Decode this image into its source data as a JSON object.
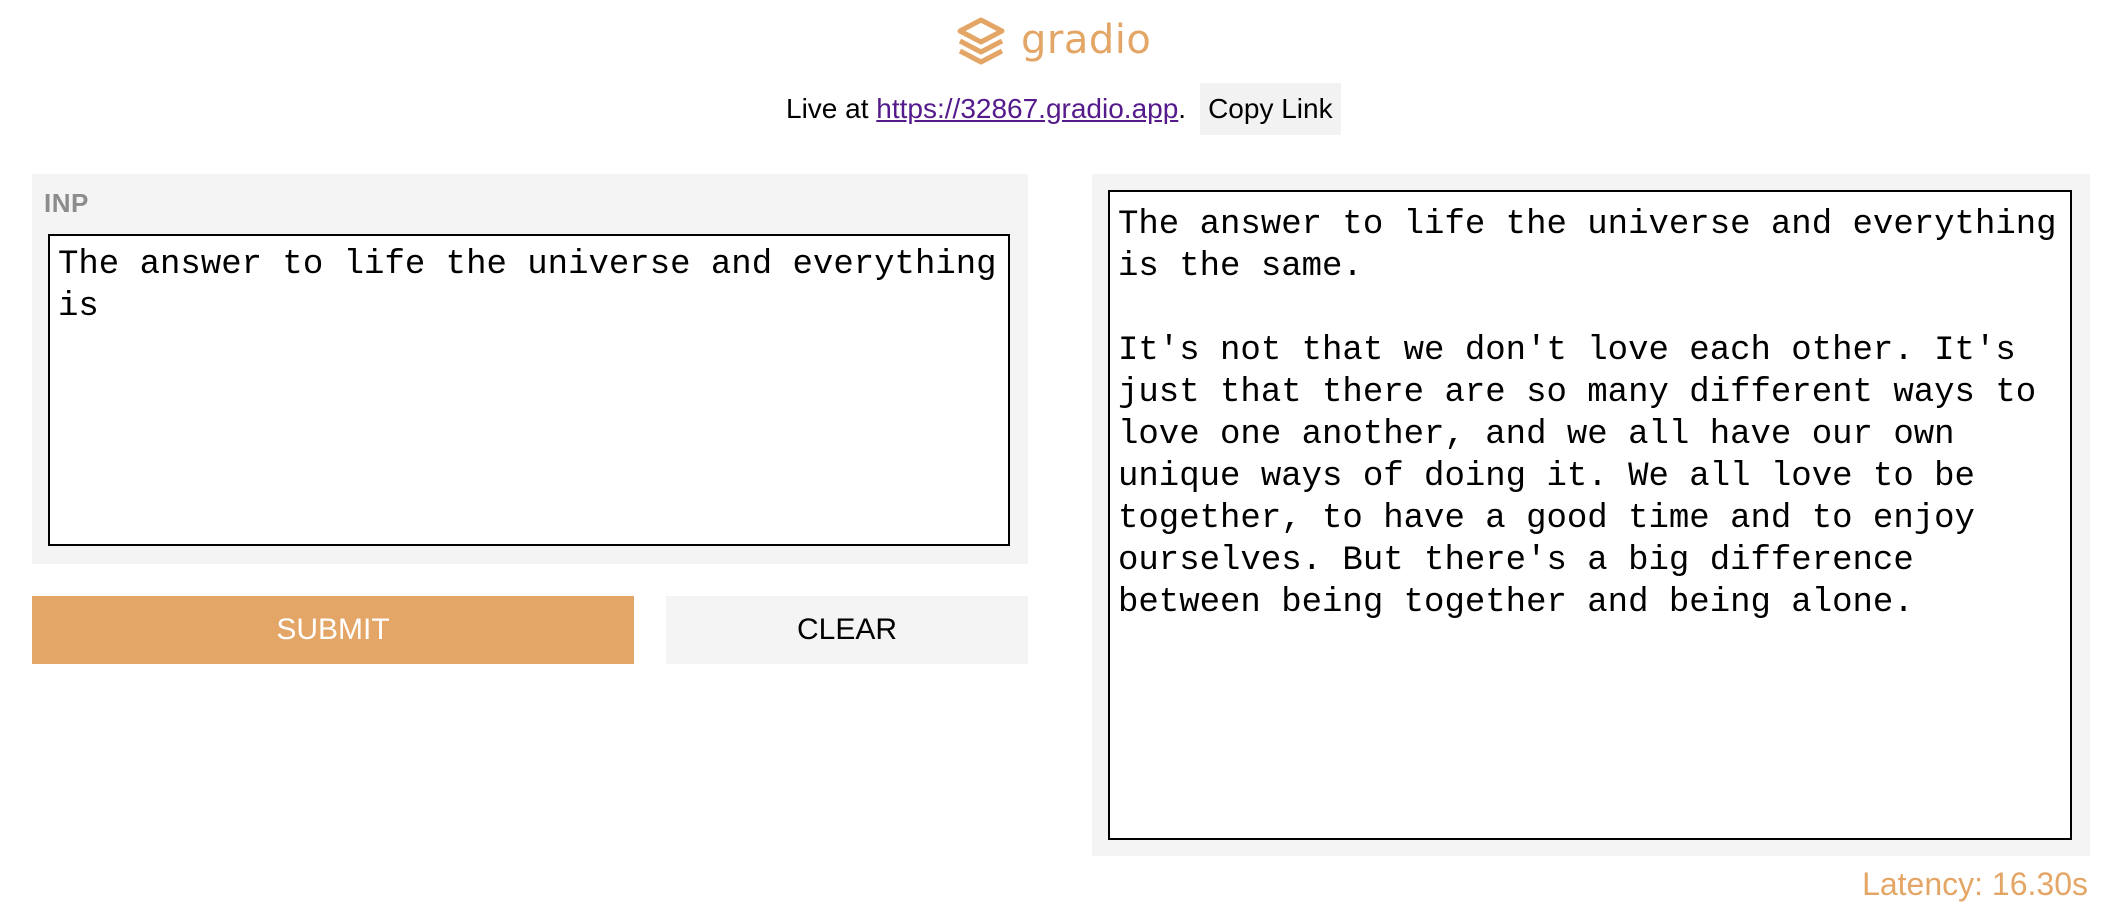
{
  "header": {
    "logo_text": "gradio",
    "logo_icon": "gradio-logo-icon",
    "live_prefix": "Live at ",
    "live_url": "https://32867.gradio.app",
    "live_suffix": ".",
    "copy_link_label": "Copy Link"
  },
  "input": {
    "label": "INP",
    "value": "The answer to life the universe and everything is"
  },
  "buttons": {
    "submit_label": "SUBMIT",
    "clear_label": "CLEAR"
  },
  "output": {
    "value": "The answer to life the universe and everything is the same.\n\nIt's not that we don't love each other. It's just that there are so many different ways to love one another, and we all have our own unique ways of doing it. We all love to be together, to have a good time and to enjoy ourselves. But there's a big difference between being together and being alone."
  },
  "latency": {
    "label": "Latency:",
    "value": "16.30s"
  },
  "colors": {
    "accent": "#e4a666",
    "panel_background": "#f4f4f4",
    "link": "#551a8b",
    "label_gray": "#8c8c8c"
  }
}
